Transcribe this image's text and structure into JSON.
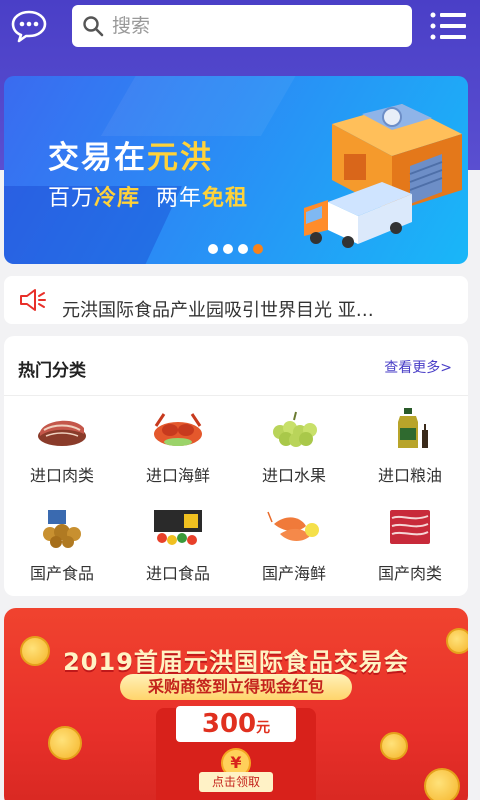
{
  "header": {
    "search_placeholder": "搜索",
    "chat_icon": "chat-bubble-icon",
    "menu_icon": "menu-list-icon"
  },
  "banner": {
    "title_prefix": "交易在",
    "title_highlight": "元洪",
    "sub_1": "百万",
    "sub_1_hl": "冷库",
    "sub_2": "两年",
    "sub_2_hl": "免租",
    "slide_count": 4,
    "active_slide": 4
  },
  "notice": {
    "text": "元洪国际食品产业园吸引世界目光 亚…"
  },
  "categories": {
    "title": "热门分类",
    "more_label": "查看更多>",
    "items": [
      {
        "label": "进口肉类",
        "icon": "meat-icon"
      },
      {
        "label": "进口海鲜",
        "icon": "seafood-icon"
      },
      {
        "label": "进口水果",
        "icon": "fruit-icon"
      },
      {
        "label": "进口粮油",
        "icon": "oil-icon"
      },
      {
        "label": "国产食品",
        "icon": "snack-icon"
      },
      {
        "label": "进口食品",
        "icon": "packaged-food-icon"
      },
      {
        "label": "国产海鲜",
        "icon": "shrimp-icon"
      },
      {
        "label": "国产肉类",
        "icon": "beef-icon"
      }
    ]
  },
  "promo": {
    "title": "2019首届元洪国际食品交易会",
    "pill": "采购商签到立得现金红包",
    "amount": "300",
    "amount_unit": "元",
    "coin_symbol": "¥",
    "claim_label": "点击领取"
  },
  "colors": {
    "brand_purple": "#4a3fc7",
    "accent_orange": "#f7821b",
    "promo_red": "#e8302a",
    "highlight_yellow": "#ffd23a"
  }
}
